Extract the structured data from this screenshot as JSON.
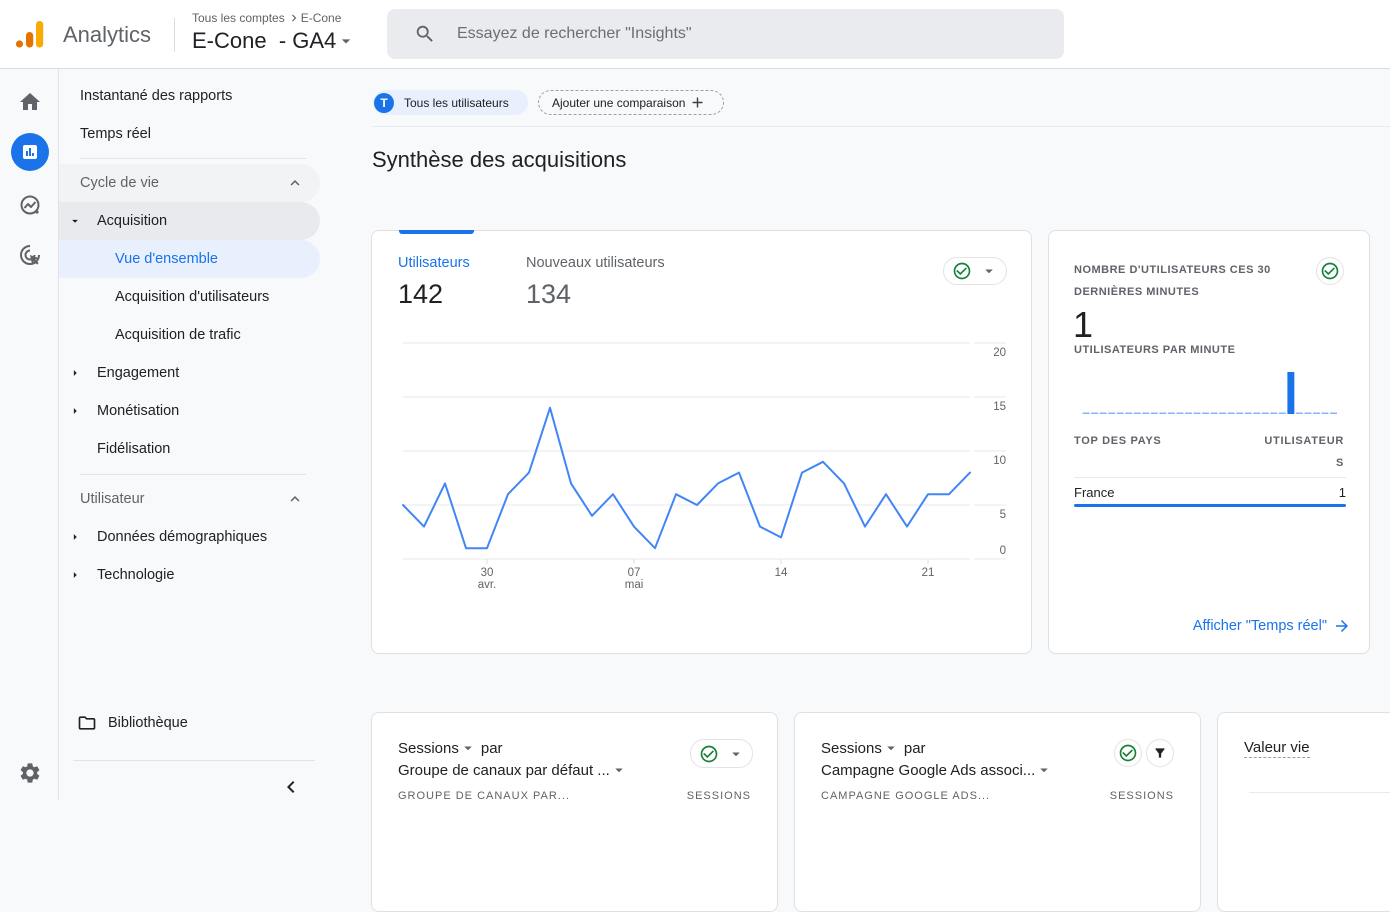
{
  "header": {
    "app_name": "Analytics",
    "breadcrumb": {
      "root": "Tous les comptes",
      "account": "E-Cone"
    },
    "property": "E-Cone  - GA4",
    "search_placeholder": "Essayez de rechercher \"Insights\""
  },
  "rail": {
    "icons": [
      "home-icon",
      "reports-icon",
      "explore-icon",
      "advertising-icon"
    ],
    "active_index": 1,
    "bottom_icon": "gear-icon"
  },
  "sidebar": {
    "top_items": [
      {
        "label": "Instantané des rapports"
      },
      {
        "label": "Temps réel"
      }
    ],
    "lifecycle": {
      "title": "Cycle de vie",
      "expanded": true,
      "items": [
        {
          "label": "Acquisition",
          "expanded": true,
          "children": [
            {
              "label": "Vue d'ensemble",
              "active": true
            },
            {
              "label": "Acquisition d'utilisateurs"
            },
            {
              "label": "Acquisition de trafic"
            }
          ]
        },
        {
          "label": "Engagement",
          "expanded": false
        },
        {
          "label": "Monétisation",
          "expanded": false
        },
        {
          "label": "Fidélisation"
        }
      ]
    },
    "user": {
      "title": "Utilisateur",
      "expanded": true,
      "items": [
        {
          "label": "Données démographiques",
          "expanded": false
        },
        {
          "label": "Technologie",
          "expanded": false
        }
      ]
    },
    "library": "Bibliothèque"
  },
  "main": {
    "comparison": {
      "segment_avatar": "T",
      "segment_label": "Tous les utilisateurs",
      "add_comparison": "Ajouter une comparaison"
    },
    "title": "Synthèse des acquisitions",
    "overview_card": {
      "metrics": [
        {
          "label": "Utilisateurs",
          "value": "142",
          "active": true
        },
        {
          "label": "Nouveaux utilisateurs",
          "value": "134",
          "active": false
        }
      ]
    },
    "realtime_card": {
      "title": "NOMBRE D'UTILISATEURS CES 30 DERNIÈRES MINUTES",
      "value": "1",
      "per_minute_label": "UTILISATEURS PAR MINUTE",
      "countries_header": "TOP DES PAYS",
      "users_header": "UTILISATEURS",
      "rows": [
        {
          "country": "France",
          "users": "1",
          "share": 1.0
        }
      ],
      "link": "Afficher \"Temps réel\""
    },
    "cards": [
      {
        "metric": "Sessions",
        "connector": "par",
        "dimension": "Groupe de canaux par défaut ...",
        "col_dimension": "GROUPE DE CANAUX PAR...",
        "col_metric": "SESSIONS"
      },
      {
        "metric": "Sessions",
        "connector": "par",
        "dimension": "Campagne Google Ads associ...",
        "col_dimension": "CAMPAGNE GOOGLE ADS...",
        "col_metric": "SESSIONS"
      },
      {
        "title": "Valeur vie"
      }
    ]
  },
  "colors": {
    "accent": "#1a73e8",
    "line": "#4285f4",
    "success": "#188038",
    "logo_dark": "#e37400",
    "logo_light": "#f9ab00"
  },
  "chart_data": [
    {
      "type": "line",
      "title": "Utilisateurs",
      "xlabel": "",
      "ylabel": "",
      "x": [
        "26 avr.",
        "27 avr.",
        "28 avr.",
        "29 avr.",
        "30 avr.",
        "01 mai",
        "02 mai",
        "03 mai",
        "04 mai",
        "05 mai",
        "06 mai",
        "07 mai",
        "08 mai",
        "09 mai",
        "10 mai",
        "11 mai",
        "12 mai",
        "13 mai",
        "14 mai",
        "15 mai",
        "16 mai",
        "17 mai",
        "18 mai",
        "19 mai",
        "20 mai",
        "21 mai",
        "22 mai",
        "23 mai"
      ],
      "series": [
        {
          "name": "Utilisateurs",
          "values": [
            5,
            3,
            7,
            1,
            1,
            6,
            8,
            14,
            7,
            4,
            6,
            3,
            1,
            6,
            5,
            7,
            8,
            3,
            2,
            8,
            9,
            7,
            3,
            6,
            3,
            6,
            6,
            8
          ]
        }
      ],
      "x_ticks": [
        {
          "index": 4,
          "day": "30",
          "month": "avr."
        },
        {
          "index": 11,
          "day": "07",
          "month": "mai"
        },
        {
          "index": 18,
          "day": "14",
          "month": ""
        },
        {
          "index": 25,
          "day": "21",
          "month": ""
        }
      ],
      "ylim": [
        0,
        20
      ],
      "yticks": [
        0,
        5,
        10,
        15,
        20
      ],
      "y_axis_side": "right",
      "grid": true,
      "legend": "none"
    },
    {
      "type": "bar",
      "title": "UTILISATEURS PAR MINUTE",
      "values": [
        0,
        0,
        0,
        0,
        0,
        0,
        0,
        0,
        0,
        0,
        0,
        0,
        0,
        0,
        0,
        0,
        0,
        0,
        0,
        0,
        0,
        0,
        0,
        0,
        1,
        0,
        0,
        0,
        0,
        0
      ],
      "ylim": [
        0,
        1
      ],
      "grid": false
    }
  ]
}
